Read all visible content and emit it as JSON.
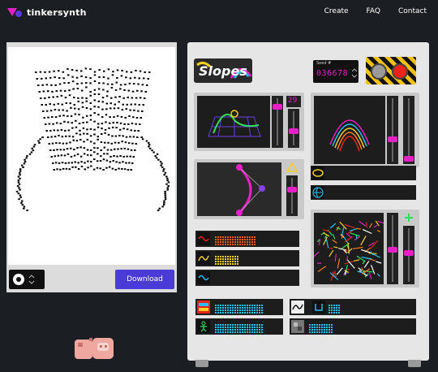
{
  "brand": {
    "name": "tinkersynth"
  },
  "nav": {
    "create": "Create",
    "faq": "FAQ",
    "contact": "Contact"
  },
  "preview": {
    "download_label": "Download"
  },
  "synth": {
    "title": "Slopes",
    "seed_label": "Seed #",
    "seed_value": "036678",
    "top_counter": "29",
    "colors": {
      "accent": "#e81ec6",
      "download": "#4a3bd6",
      "panel": "#e6e6e6"
    }
  }
}
